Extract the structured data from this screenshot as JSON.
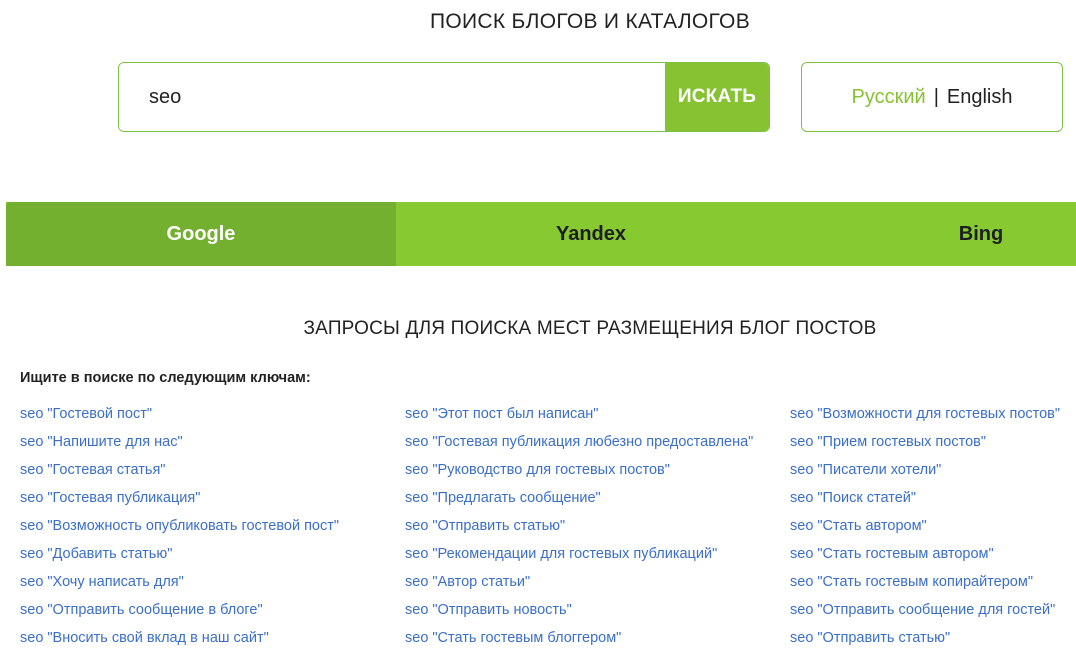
{
  "header": {
    "title": "ПОИСК БЛОГОВ И КАТАЛОГОВ"
  },
  "search": {
    "value": "seo",
    "button_label": "ИСКАТЬ"
  },
  "language": {
    "active": "Русский",
    "separator": "|",
    "other": "English"
  },
  "tabs": [
    {
      "label": "Google"
    },
    {
      "label": "Yandex"
    },
    {
      "label": "Bing"
    }
  ],
  "section": {
    "title": "ЗАПРОСЫ ДЛЯ ПОИСКА МЕСТ РАЗМЕЩЕНИЯ БЛОГ ПОСТОВ",
    "intro": "Ищите в поиске по следующим ключам:"
  },
  "queries": {
    "col1": [
      "seo \"Гостевой пост\"",
      "seo \"Напишите для нас\"",
      "seo \"Гостевая статья\"",
      "seo \"Гостевая публикация\"",
      "seo \"Возможность опубликовать гостевой пост\"",
      "seo \"Добавить статью\"",
      "seo \"Хочу написать для\"",
      "seo \"Отправить сообщение в блоге\"",
      "seo \"Вносить свой вклад в наш сайт\""
    ],
    "col2": [
      "seo \"Этот пост был написан\"",
      "seo \"Гостевая публикация любезно предоставлена\"",
      "seo \"Руководство для гостевых постов\"",
      "seo \"Предлагать сообщение\"",
      "seo \"Отправить статью\"",
      "seo \"Рекомендации для гостевых публикаций\"",
      "seo \"Автор статьи\"",
      "seo \"Отправить новость\"",
      "seo \"Стать гостевым блоггером\""
    ],
    "col3": [
      "seo \"Возможности для гостевых постов\"",
      "seo \"Прием гостевых постов\"",
      "seo \"Писатели хотели\"",
      "seo \"Поиск статей\"",
      "seo \"Стать автором\"",
      "seo \"Стать гостевым автором\"",
      "seo \"Стать гостевым копирайтером\"",
      "seo \"Отправить сообщение для гостей\"",
      "seo \"Отправить статью\""
    ]
  }
}
